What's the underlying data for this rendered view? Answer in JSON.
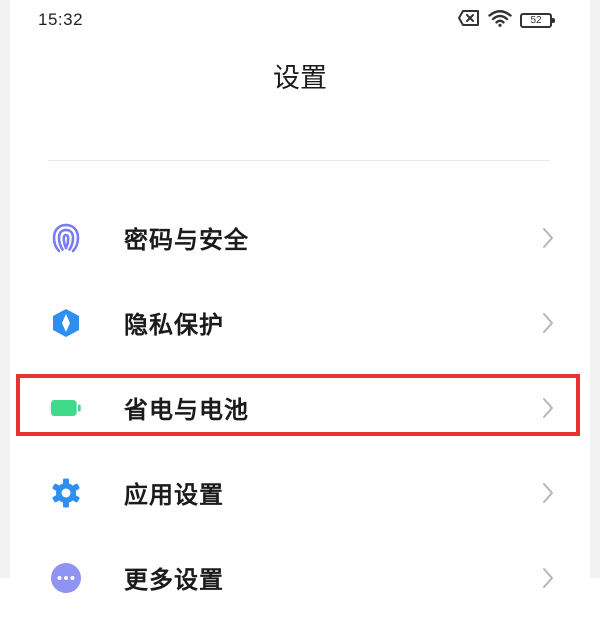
{
  "status_bar": {
    "time": "15:32",
    "battery_level": "52",
    "icons": [
      "sim-card-x-icon",
      "wifi-icon",
      "battery-icon"
    ]
  },
  "header": {
    "title": "设置"
  },
  "menu": {
    "items": [
      {
        "label": "密码与安全",
        "icon": "fingerprint-icon",
        "icon_color": "#7b7cf0"
      },
      {
        "label": "隐私保护",
        "icon": "privacy-shield-icon",
        "icon_color": "#2f8ff0"
      },
      {
        "label": "省电与电池",
        "icon": "battery-icon",
        "icon_color": "#3fd98a",
        "highlighted": true
      },
      {
        "label": "应用设置",
        "icon": "gear-icon",
        "icon_color": "#2f8ff0"
      },
      {
        "label": "更多设置",
        "icon": "more-dots-icon",
        "icon_color": "#8f93f2"
      }
    ]
  },
  "colors": {
    "highlight_border": "#e63333",
    "chevron": "#b5b5b5"
  }
}
